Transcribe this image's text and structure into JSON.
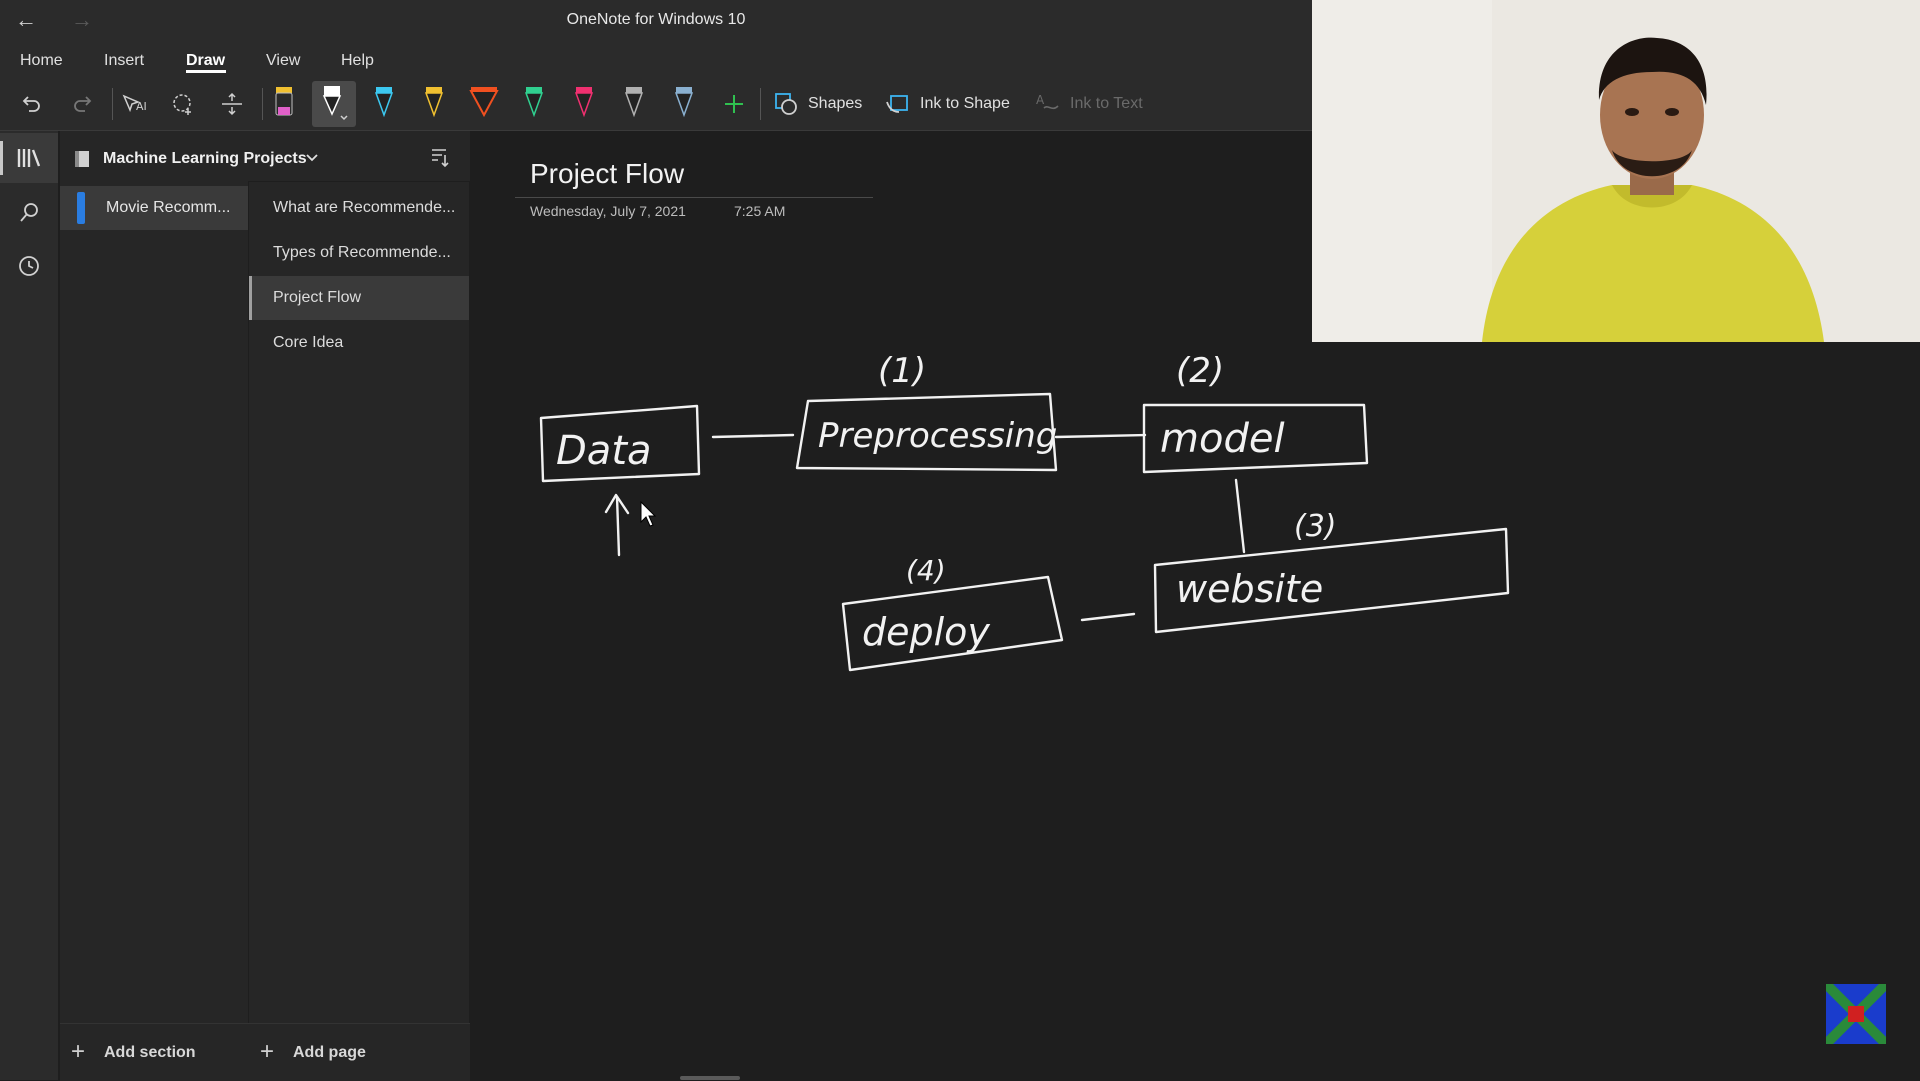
{
  "app": {
    "title": "OneNote for Windows 10"
  },
  "menu": {
    "items": [
      "Home",
      "Insert",
      "Draw",
      "View",
      "Help"
    ],
    "active": "Draw"
  },
  "toolbar": {
    "shapes_label": "Shapes",
    "ink_to_shape_label": "Ink to Shape",
    "ink_to_text_label": "Ink to Text",
    "pens": [
      {
        "name": "highlighter-pen-icon",
        "color": "#e060c8"
      },
      {
        "name": "white-pen-icon",
        "color": "#ffffff"
      },
      {
        "name": "cyan-pen-icon",
        "color": "#3cc8f0"
      },
      {
        "name": "yellow-pen-icon",
        "color": "#f0c030"
      },
      {
        "name": "orange-pen-icon",
        "color": "#f05020"
      },
      {
        "name": "green-pen-icon",
        "color": "#30d090"
      },
      {
        "name": "pink-pen-icon",
        "color": "#f03070"
      },
      {
        "name": "galaxy-pen-icon",
        "color": "#b0b0b0"
      },
      {
        "name": "silver-pen-icon",
        "color": "#8ab0d0"
      }
    ]
  },
  "notebook": {
    "name": "Machine Learning Projects",
    "sections": [
      "Movie Recomm..."
    ],
    "pages": [
      "What are Recommende...",
      "Types of Recommende...",
      "Project Flow",
      "Core Idea"
    ],
    "active_page": "Project Flow",
    "add_section_label": "Add section",
    "add_page_label": "Add page"
  },
  "page": {
    "title": "Project Flow",
    "date": "Wednesday, July 7, 2021",
    "time": "7:25 AM"
  },
  "ink": {
    "data": "Data",
    "preprocessing": "Preprocessing",
    "model": "model",
    "website": "website",
    "deploy": "deploy",
    "step1": "(1)",
    "step2": "(2)",
    "step3": "(3)",
    "step4": "(4)"
  }
}
